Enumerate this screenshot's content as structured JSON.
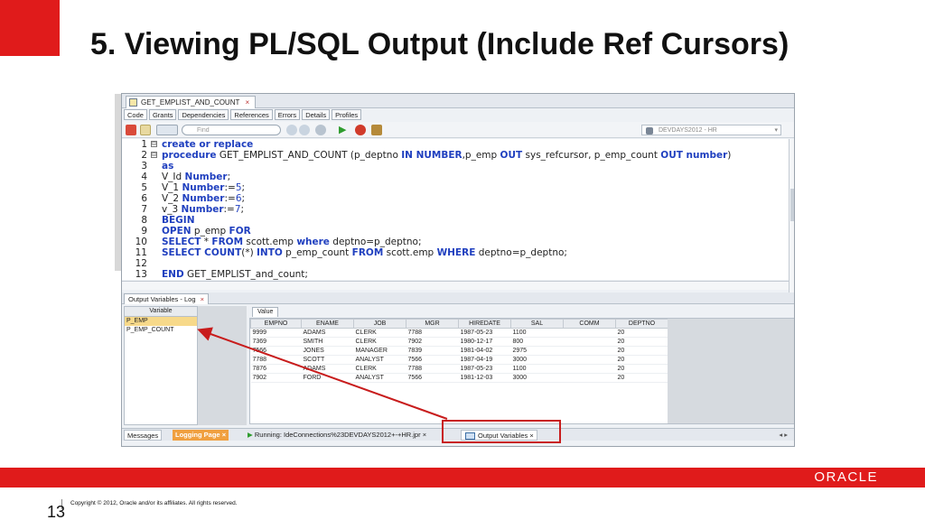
{
  "slide": {
    "title": "5. Viewing PL/SQL Output (Include Ref Cursors)",
    "page_number": "13",
    "copyright": "Copyright © 2012, Oracle and/or its affiliates. All rights reserved.",
    "logo_text": "ORACLE",
    "accent_color": "#e01b1b"
  },
  "editor": {
    "tab_label": "GET_EMPLIST_AND_COUNT",
    "tab_close": "×",
    "sub_tabs": [
      "Code",
      "Grants",
      "Dependencies",
      "References",
      "Errors",
      "Details",
      "Profiles"
    ],
    "find_placeholder": "Find",
    "connection": "DEVDAYS2012 - HR",
    "icons": [
      "run-icon",
      "debug-icon",
      "compile-icon",
      "find-icon",
      "back-icon",
      "forward-icon",
      "settings-icon",
      "play-icon",
      "bug-icon",
      "profile-icon"
    ]
  },
  "code_lines": [
    {
      "n": "1",
      "fold": "⊟",
      "parts": [
        [
          "kw",
          "create or replace"
        ]
      ]
    },
    {
      "n": "2",
      "fold": "⊟",
      "parts": [
        [
          "kw",
          "procedure"
        ],
        [
          "t",
          " GET_EMPLIST_AND_COUNT (p_deptno "
        ],
        [
          "kw",
          "IN NUMBER"
        ],
        [
          "t",
          ",p_emp "
        ],
        [
          "kw",
          "OUT"
        ],
        [
          "t",
          " sys_refcursor, p_emp_count "
        ],
        [
          "kw",
          "OUT number"
        ],
        [
          "t",
          ")"
        ]
      ]
    },
    {
      "n": "3",
      "fold": "",
      "parts": [
        [
          "kw",
          "as"
        ]
      ]
    },
    {
      "n": "4",
      "fold": "",
      "parts": [
        [
          "t",
          "V_Id "
        ],
        [
          "kw",
          "Number"
        ],
        [
          "t",
          ";"
        ]
      ]
    },
    {
      "n": "5",
      "fold": "",
      "parts": [
        [
          "t",
          "V_1 "
        ],
        [
          "kw",
          "Number"
        ],
        [
          "t",
          ":="
        ],
        [
          "kwo",
          "5"
        ],
        [
          "t",
          ";"
        ]
      ]
    },
    {
      "n": "6",
      "fold": "",
      "parts": [
        [
          "t",
          "V_2 "
        ],
        [
          "kw",
          "Number"
        ],
        [
          "t",
          ":="
        ],
        [
          "kwo",
          "6"
        ],
        [
          "t",
          ";"
        ]
      ]
    },
    {
      "n": "7",
      "fold": "",
      "parts": [
        [
          "t",
          "v_3 "
        ],
        [
          "kw",
          "Number"
        ],
        [
          "t",
          ":="
        ],
        [
          "kwo",
          "7"
        ],
        [
          "t",
          ";"
        ]
      ]
    },
    {
      "n": "8",
      "fold": "",
      "parts": [
        [
          "kw",
          "BEGIN"
        ]
      ]
    },
    {
      "n": "9",
      "fold": "",
      "parts": [
        [
          "kw",
          "OPEN"
        ],
        [
          "t",
          " p_emp "
        ],
        [
          "kw",
          "FOR"
        ]
      ]
    },
    {
      "n": "10",
      "fold": "",
      "parts": [
        [
          "kw",
          "SELECT"
        ],
        [
          "t",
          " * "
        ],
        [
          "kw",
          "FROM"
        ],
        [
          "t",
          " scott.emp "
        ],
        [
          "kw",
          "where"
        ],
        [
          "t",
          " deptno=p_deptno;"
        ]
      ]
    },
    {
      "n": "11",
      "fold": "",
      "parts": [
        [
          "kw",
          "SELECT COUNT"
        ],
        [
          "t",
          "(*) "
        ],
        [
          "kw",
          "INTO"
        ],
        [
          "t",
          " p_emp_count "
        ],
        [
          "kw",
          "FROM"
        ],
        [
          "t",
          " scott.emp "
        ],
        [
          "kw",
          "WHERE"
        ],
        [
          "t",
          " deptno=p_deptno;"
        ]
      ]
    },
    {
      "n": "12",
      "fold": "",
      "parts": []
    },
    {
      "n": "13",
      "fold": "",
      "parts": [
        [
          "kw",
          "END"
        ],
        [
          "t",
          " GET_EMPLIST_and_count;"
        ]
      ]
    }
  ],
  "log_panel": {
    "tab_label": "Output Variables - Log",
    "tab_close": "×",
    "variable_header": "Variable",
    "variables": [
      "P_EMP",
      "P_EMP_COUNT"
    ],
    "value_tab": "Value",
    "columns": [
      "EMPNO",
      "ENAME",
      "JOB",
      "MGR",
      "HIREDATE",
      "SAL",
      "COMM",
      "DEPTNO"
    ],
    "rows": [
      [
        "9999",
        "ADAMS",
        "CLERK",
        "7788",
        "1987-05-23",
        "1100",
        "",
        "20"
      ],
      [
        "7369",
        "SMITH",
        "CLERK",
        "7902",
        "1980-12-17",
        "800",
        "",
        "20"
      ],
      [
        "7566",
        "JONES",
        "MANAGER",
        "7839",
        "1981-04-02",
        "2975",
        "",
        "20"
      ],
      [
        "7788",
        "SCOTT",
        "ANALYST",
        "7566",
        "1987-04-19",
        "3000",
        "",
        "20"
      ],
      [
        "7876",
        "ADAMS",
        "CLERK",
        "7788",
        "1987-05-23",
        "1100",
        "",
        "20"
      ],
      [
        "7902",
        "FORD",
        "ANALYST",
        "7566",
        "1981-12-03",
        "3000",
        "",
        "20"
      ]
    ]
  },
  "status_bar": {
    "messages": "Messages",
    "logging": "Logging Page",
    "running": "Running: IdeConnections%23DEVDAYS2012+-+HR.jpr",
    "output_variables": "Output Variables",
    "close": "×",
    "nav": "◂ ▸"
  }
}
